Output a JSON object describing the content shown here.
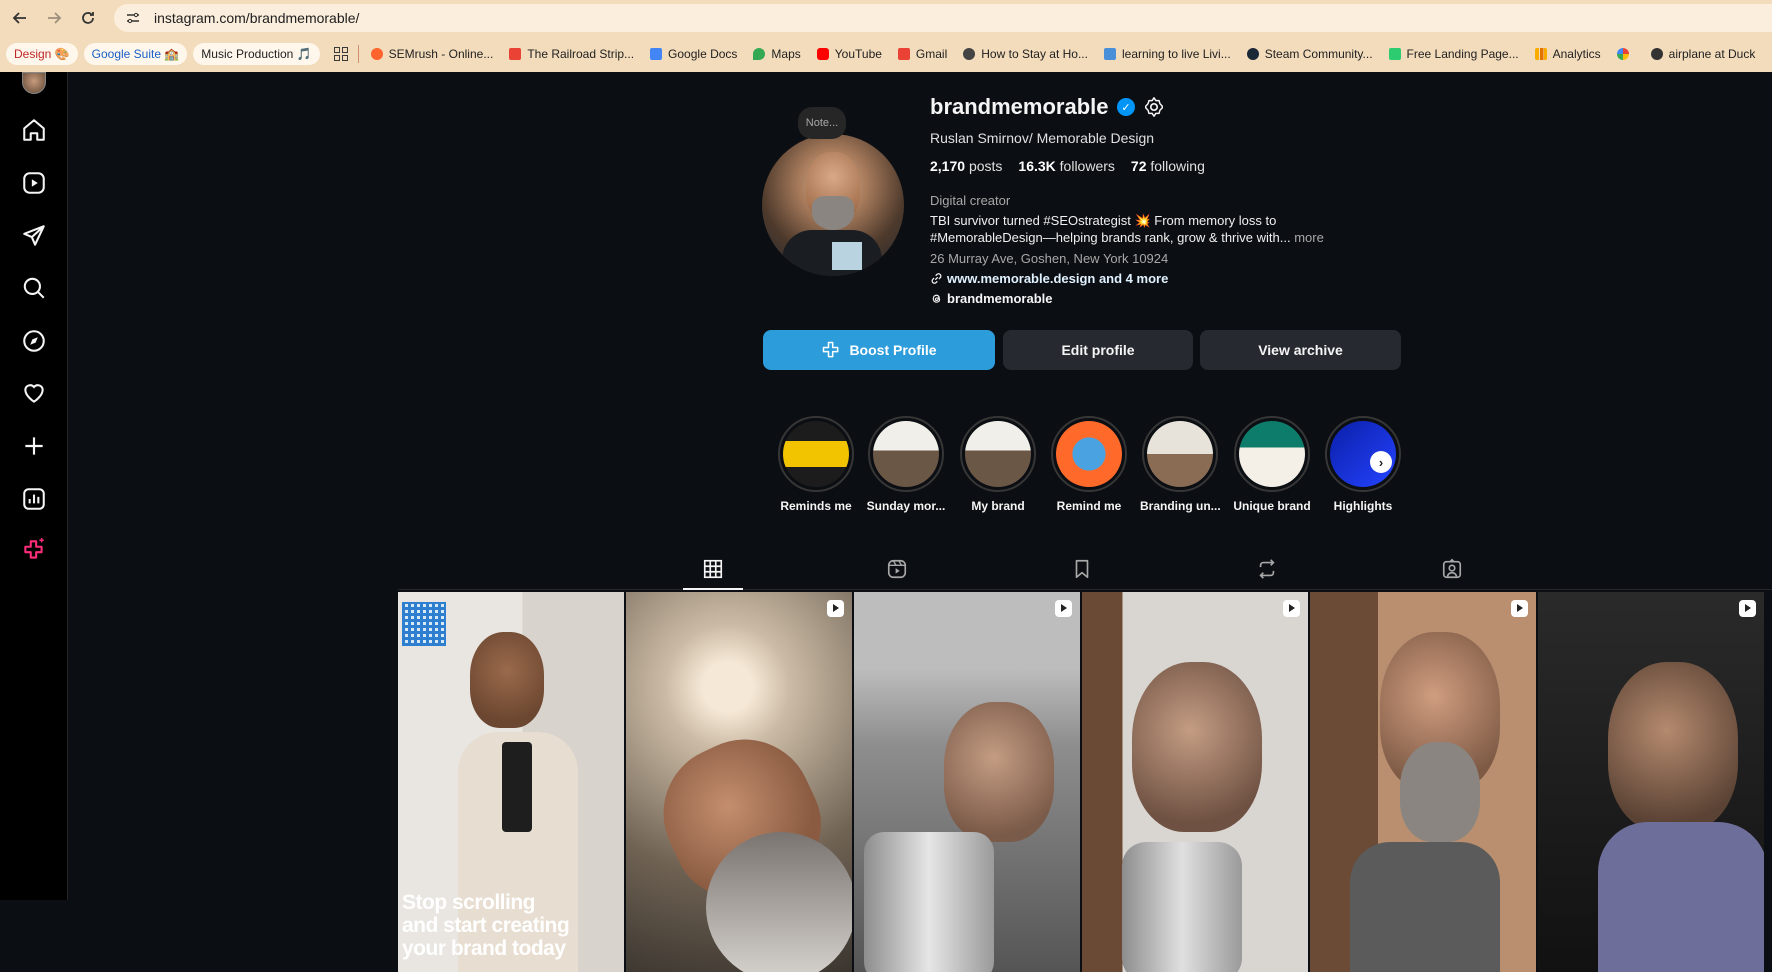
{
  "browser": {
    "url": "instagram.com/brandmemorable/",
    "bookmarks": [
      {
        "label": "Design 🎨",
        "pill": true,
        "color": "#e04040"
      },
      {
        "label": "Google Suite 🏫",
        "pill": true,
        "color": "#1a73e8"
      },
      {
        "label": "Music Production 🎵",
        "pill": true,
        "color": "#7a5a3a"
      },
      {
        "label": "SEMrush - Online...",
        "color": "#ff642d"
      },
      {
        "label": "The Railroad Strip...",
        "color": "#ea4335"
      },
      {
        "label": "Google Docs",
        "color": "#4285f4"
      },
      {
        "label": "Maps",
        "color": "#34a853"
      },
      {
        "label": "YouTube",
        "color": "#ff0000"
      },
      {
        "label": "Gmail",
        "color": "#ea4335"
      },
      {
        "label": "How to Stay at Ho...",
        "color": "#444444"
      },
      {
        "label": "learning to live Livi...",
        "color": "#4a90d9"
      },
      {
        "label": "Steam Community...",
        "color": "#1b2838"
      },
      {
        "label": "Free Landing Page...",
        "color": "#2ecc71"
      },
      {
        "label": "Analytics",
        "color": "#f9ab00"
      },
      {
        "label": "",
        "color": "#4285f4"
      },
      {
        "label": "airplane at Duck",
        "color": "#333333"
      }
    ]
  },
  "profile": {
    "note": "Note...",
    "username": "brandmemorable",
    "verified_mark": "✓",
    "full_name": "Ruslan Smirnov/ Memorable Design",
    "posts_count": "2,170",
    "posts_label": "posts",
    "followers_count": "16.3K",
    "followers_label": "followers",
    "following_count": "72",
    "following_label": "following",
    "category": "Digital creator",
    "bio_line1": "TBI survivor turned #SEOstrategist 💥 From memory loss to",
    "bio_line2": "#MemorableDesign—helping brands rank, grow & thrive with...",
    "more": "more",
    "address": "26 Murray Ave, Goshen, New York 10924",
    "link": "www.memorable.design and 4 more",
    "threads": "brandmemorable",
    "boost_label": "Boost Profile",
    "edit_label": "Edit profile",
    "archive_label": "View archive"
  },
  "highlights": [
    {
      "label": "Reminds me",
      "bg": "linear-gradient(#1c1c1c 0 30%, #f2c400 30% 70%, #1c1c1c 70%)"
    },
    {
      "label": "Sunday mor...",
      "bg": "linear-gradient(#f1efe9 0 45%, #6b5746 45%)"
    },
    {
      "label": "My brand",
      "bg": "linear-gradient(#f1efe9 0 45%, #6b5746 45%)"
    },
    {
      "label": "Remind me",
      "bg": "radial-gradient(circle, #4aa3e0 0 35%, #ff6a2a 36% 100%)"
    },
    {
      "label": "Branding un...",
      "bg": "linear-gradient(#e8e3da 0 50%, #8a6b54 50%)"
    },
    {
      "label": "Unique brand",
      "bg": "linear-gradient(#0e7c6b 0 40%, #f4efe7 40%)"
    },
    {
      "label": "Highlights",
      "bg": "linear-gradient(135deg, #0b1fa8, #2443ff)"
    }
  ],
  "grid": {
    "post1_text": "Stop scrolling and start creating your brand today"
  },
  "colors": {
    "accent": "#2d9cdb",
    "verified": "#0095f6",
    "background": "#0b0e12"
  }
}
